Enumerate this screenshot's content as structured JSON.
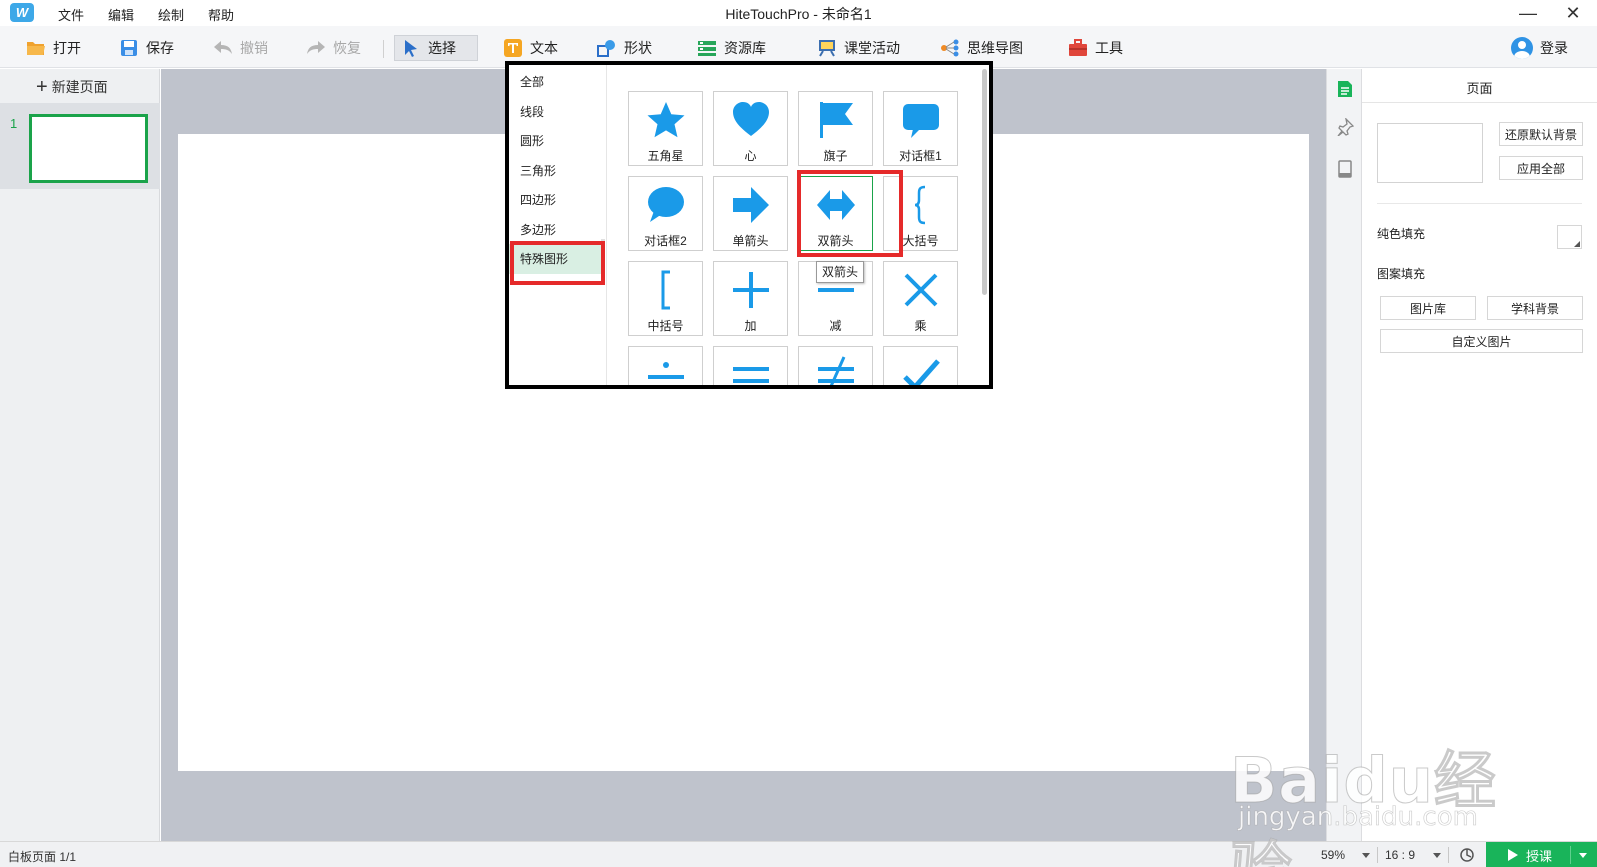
{
  "app": {
    "title": "HiteTouchPro - 未命名1",
    "menu": [
      "文件",
      "编辑",
      "绘制",
      "帮助"
    ],
    "window_controls": [
      "—",
      "✕"
    ]
  },
  "toolbar": {
    "open": "打开",
    "save": "保存",
    "undo": "撤销",
    "redo": "恢复",
    "select": "选择",
    "text": "文本",
    "shape": "形状",
    "resources": "资源库",
    "class_activity": "课堂活动",
    "mindmap": "思维导图",
    "tools": "工具",
    "login": "登录"
  },
  "pages_panel": {
    "new_page": "新建页面",
    "pages": [
      {
        "number": "1"
      }
    ]
  },
  "shapes_popup": {
    "categories": [
      "全部",
      "线段",
      "圆形",
      "三角形",
      "四边形",
      "多边形",
      "特殊图形"
    ],
    "active_category": "特殊图形",
    "shapes": [
      {
        "label": "五角星",
        "icon": "star-icon"
      },
      {
        "label": "心",
        "icon": "heart-icon"
      },
      {
        "label": "旗子",
        "icon": "flag-icon"
      },
      {
        "label": "对话框1",
        "icon": "speech-bubble-rect-icon"
      },
      {
        "label": "对话框2",
        "icon": "speech-bubble-round-icon"
      },
      {
        "label": "单箭头",
        "icon": "arrow-right-icon"
      },
      {
        "label": "双箭头",
        "icon": "double-arrow-icon"
      },
      {
        "label": "大括号",
        "icon": "curly-brace-icon"
      },
      {
        "label": "中括号",
        "icon": "square-bracket-icon"
      },
      {
        "label": "加",
        "icon": "plus-icon"
      },
      {
        "label": "减",
        "icon": "minus-icon"
      },
      {
        "label": "乘",
        "icon": "times-icon"
      },
      {
        "label": "",
        "icon": "divide-icon"
      },
      {
        "label": "",
        "icon": "equals-icon"
      },
      {
        "label": "",
        "icon": "not-equal-icon"
      },
      {
        "label": "",
        "icon": "check-icon"
      }
    ],
    "tooltip": "双箭头"
  },
  "right_panel": {
    "title": "页面",
    "restore_default_bg": "还原默认背景",
    "apply_all": "应用全部",
    "solid_fill": "纯色填充",
    "pattern_fill": "图案填充",
    "gallery": "图片库",
    "subject_bg": "学科背景",
    "custom_image": "自定义图片"
  },
  "status": {
    "page_info": "白板页面 1/1",
    "zoom": "59%",
    "ratio": "16 : 9",
    "teach": "授课"
  },
  "watermark": {
    "main": "Baidu经验",
    "sub": "jingyan.baidu.com"
  },
  "colors": {
    "accent_blue": "#1a9ae8",
    "accent_green": "#1aa34a",
    "highlight_red": "#e52a2a"
  }
}
